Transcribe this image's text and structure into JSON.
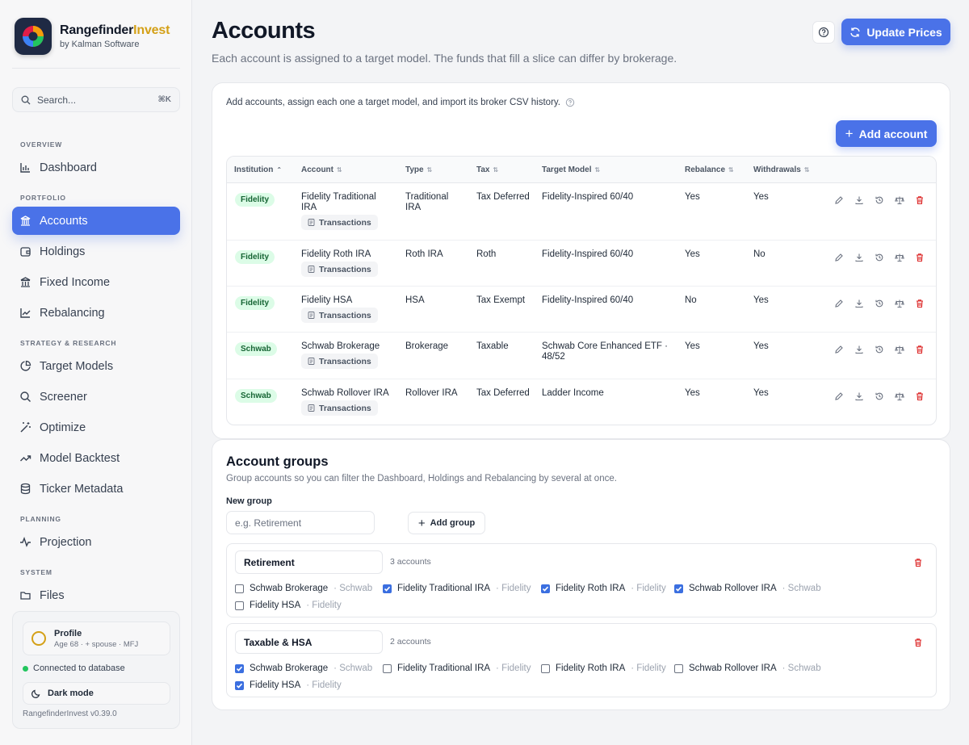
{
  "brand": {
    "name_main": "Rangefinder",
    "name_accent": "Invest",
    "subtitle": "by Kalman Software"
  },
  "search": {
    "placeholder": "Search...",
    "shortcut": "⌘K"
  },
  "nav": {
    "sections": {
      "overview": "OVERVIEW",
      "portfolio": "PORTFOLIO",
      "strategy": "STRATEGY & RESEARCH",
      "planning": "PLANNING",
      "system": "SYSTEM"
    },
    "items": {
      "dashboard": "Dashboard",
      "accounts": "Accounts",
      "holdings": "Holdings",
      "fixed_income": "Fixed Income",
      "rebalancing": "Rebalancing",
      "target_models": "Target Models",
      "screener": "Screener",
      "optimize": "Optimize",
      "model_backtest": "Model Backtest",
      "ticker_metadata": "Ticker Metadata",
      "projection": "Projection",
      "files": "Files"
    },
    "active": "accounts"
  },
  "footer": {
    "profile_title": "Profile",
    "profile_sub": "Age 68 · + spouse · MFJ",
    "db_status": "Connected to database",
    "dark_mode": "Dark mode",
    "version": "RangefinderInvest v0.39.0"
  },
  "header": {
    "title": "Accounts",
    "subtitle": "Each account is assigned to a target model. The funds that fill a slice can differ by brokerage.",
    "update_prices": "Update Prices"
  },
  "accounts_panel": {
    "intro": "Add accounts, assign each one a target model, and import its broker CSV history.",
    "add_account": "Add account",
    "transactions_label": "Transactions",
    "columns": {
      "institution": "Institution",
      "account": "Account",
      "type": "Type",
      "tax": "Tax",
      "target_model": "Target Model",
      "rebalance": "Rebalance",
      "withdrawals": "Withdrawals"
    },
    "rows": [
      {
        "institution": "Fidelity",
        "account": "Fidelity Traditional IRA",
        "type": "Traditional IRA",
        "tax": "Tax Deferred",
        "target_model": "Fidelity-Inspired 60/40",
        "rebalance": "Yes",
        "withdrawals": "Yes"
      },
      {
        "institution": "Fidelity",
        "account": "Fidelity Roth IRA",
        "type": "Roth IRA",
        "tax": "Roth",
        "target_model": "Fidelity-Inspired 60/40",
        "rebalance": "Yes",
        "withdrawals": "No"
      },
      {
        "institution": "Fidelity",
        "account": "Fidelity HSA",
        "type": "HSA",
        "tax": "Tax Exempt",
        "target_model": "Fidelity-Inspired 60/40",
        "rebalance": "No",
        "withdrawals": "Yes"
      },
      {
        "institution": "Schwab",
        "account": "Schwab Brokerage",
        "type": "Brokerage",
        "tax": "Taxable",
        "target_model": "Schwab Core Enhanced ETF · 48/52",
        "rebalance": "Yes",
        "withdrawals": "Yes"
      },
      {
        "institution": "Schwab",
        "account": "Schwab Rollover IRA",
        "type": "Rollover IRA",
        "tax": "Tax Deferred",
        "target_model": "Ladder Income",
        "rebalance": "Yes",
        "withdrawals": "Yes"
      }
    ]
  },
  "groups_panel": {
    "title": "Account groups",
    "subtitle": "Group accounts so you can filter the Dashboard, Holdings and Rebalancing by several at once.",
    "new_group_label": "New group",
    "new_group_placeholder": "e.g. Retirement",
    "add_group": "Add group",
    "groups": [
      {
        "name": "Retirement",
        "count": "3 accounts",
        "members": [
          {
            "account": "Schwab Brokerage",
            "inst": "· Schwab",
            "checked": false
          },
          {
            "account": "Fidelity Traditional IRA",
            "inst": "· Fidelity",
            "checked": true
          },
          {
            "account": "Fidelity Roth IRA",
            "inst": "· Fidelity",
            "checked": true
          },
          {
            "account": "Schwab Rollover IRA",
            "inst": "· Schwab",
            "checked": true
          },
          {
            "account": "Fidelity HSA",
            "inst": "· Fidelity",
            "checked": false
          }
        ]
      },
      {
        "name": "Taxable & HSA",
        "count": "2 accounts",
        "members": [
          {
            "account": "Schwab Brokerage",
            "inst": "· Schwab",
            "checked": true
          },
          {
            "account": "Fidelity Traditional IRA",
            "inst": "· Fidelity",
            "checked": false
          },
          {
            "account": "Fidelity Roth IRA",
            "inst": "· Fidelity",
            "checked": false
          },
          {
            "account": "Schwab Rollover IRA",
            "inst": "· Schwab",
            "checked": false
          },
          {
            "account": "Fidelity HSA",
            "inst": "· Fidelity",
            "checked": true
          }
        ]
      }
    ]
  },
  "colors": {
    "accent": "#4a72e8",
    "brand_gold": "#d4a017",
    "badge_bg": "#dcfce7",
    "badge_text": "#166534",
    "danger": "#dc2626"
  }
}
